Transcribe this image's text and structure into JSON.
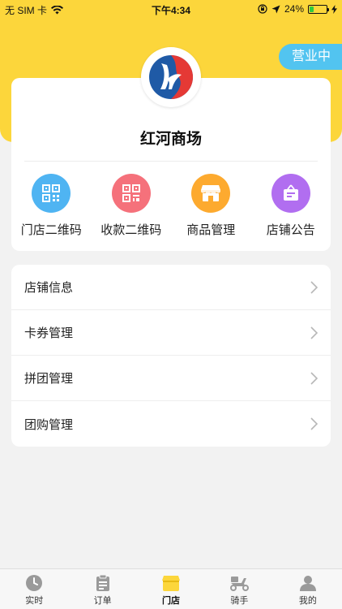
{
  "status_bar": {
    "carrier": "无 SIM 卡",
    "time": "下午4:34",
    "battery_percent": "24%",
    "battery_level": 0.24
  },
  "store": {
    "status_badge": "营业中",
    "name": "红河商场"
  },
  "quick_actions": [
    {
      "label": "门店二维码",
      "icon": "qr-code-icon",
      "color": "#4fb4f2"
    },
    {
      "label": "收款二维码",
      "icon": "payment-qr-icon",
      "color": "#f5717b"
    },
    {
      "label": "商品管理",
      "icon": "shop-icon",
      "color": "#fdaa2f"
    },
    {
      "label": "店铺公告",
      "icon": "announcement-icon",
      "color": "#b16ef0"
    }
  ],
  "menu": [
    {
      "label": "店铺信息"
    },
    {
      "label": "卡券管理"
    },
    {
      "label": "拼团管理"
    },
    {
      "label": "团购管理"
    }
  ],
  "tabs": [
    {
      "label": "实时",
      "icon": "clock-icon"
    },
    {
      "label": "订单",
      "icon": "clipboard-icon"
    },
    {
      "label": "门店",
      "icon": "store-icon",
      "active": true
    },
    {
      "label": "骑手",
      "icon": "scooter-icon"
    },
    {
      "label": "我的",
      "icon": "user-icon"
    }
  ],
  "colors": {
    "header_yellow": "#fcd63b",
    "status_pill": "#52c4f0",
    "active_tab": "#fcd63b"
  }
}
